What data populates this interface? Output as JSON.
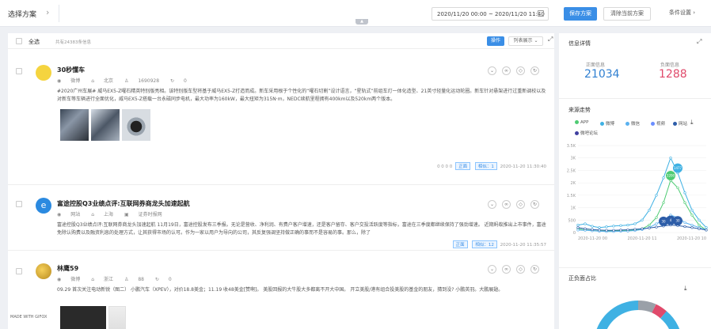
{
  "topbar": {
    "scheme_label": "选择方案",
    "date_range": "2020/11/20 00:00 ~ 2020/11/20 11:40",
    "save_label": "保存方案",
    "clear_label": "清除当前方案",
    "condition_label": "条件设置"
  },
  "list": {
    "select_all": "全选",
    "total": "共有24383条信息",
    "op_label": "操作",
    "list_mode": "列表展示"
  },
  "items": [
    {
      "title": "30秒懂车",
      "source": "微博",
      "location": "北京",
      "followers": "1690928",
      "reposts": "0",
      "content": "#2020广州车展# 威马EX5-Z曜石精英特别版亮相。该特别版车型将基于威马EX5-Z打造而成。新车采用根于个性化的“曜石切割”设计语言，“星轨式”前组车灯一体化造型、21英寸轻量化运动轮圈。新车针对悬架进行过重新调校以及对新车等车辆进行全面优化，威马EX5-Z搭载一台永磁同步电机，最大功率为160kW，最大扭矩为315N·m，NEDC续航里程拥有400km以及520km两个版本。",
      "stats": "0  0  0  0",
      "tag1": "正面",
      "tag2": "相似：1",
      "time": "2020-11-20 11:30:40"
    },
    {
      "title": "富途控股Q3业绩点评:互联网券商龙头加速起航",
      "source": "网站",
      "location": "上海",
      "extra": "证券时报网",
      "content": "富途控股Q3业绩点评:互联网券商龙头加速起航 11月19日，富途控股发布三季报。无论是营收、净利润、有费户客户增速，还是客户留存、客户交投活跃度等指标，富途在三季度都继续保持了强劲增速。 近期蚂蚁推出上市事件，富途免除认购费以及融资利息的处理方式，让其获得市场的认可。作为一家以用户为导向的公司，其反复强调坚持做正确的事而不是容易的事。那么，除了",
      "tag1": "正面",
      "tag2": "相似：12",
      "time": "2020-11-20 11:35:57"
    },
    {
      "title": "林鹰59",
      "source": "微博",
      "location": "浙江",
      "followers": "88",
      "reposts": "0",
      "content": "09.29  首次关注电动新锐（图二） 小鹏汽车（XPEV），对价18.8美金；11.19  收48美金[赞啊]。 美股回报的大牛股大多都离不开大中国。 开立美股/港有组合投美股的基金的朋友，猜到没?  小鹏英羽。大鹏展翅。"
    }
  ],
  "sidebar": {
    "info_title": "信息详情",
    "positive_label": "正面信息",
    "positive_value": "21034",
    "negative_label": "负面信息",
    "negative_value": "1288",
    "trend_title": "来源走势",
    "legend": [
      "APP",
      "微博",
      "微信",
      "视频",
      "网站",
      "微吧论坛"
    ],
    "pie_title": "正负面占比"
  },
  "chart_data": {
    "type": "line",
    "title": "来源走势",
    "y_ticks": [
      "0",
      "500",
      "1K",
      "1.5K",
      "2K",
      "2.5K",
      "3K",
      "3.5K"
    ],
    "x_ticks": [
      "2020-11-20 00",
      "2020-11-20 11",
      "2020-11-20 10"
    ],
    "ylim": [
      0,
      3500
    ],
    "colors": {
      "APP": "#4ecb73",
      "微博": "#3fb1e3",
      "微信": "#5ab1ef",
      "视频": "#6b8eff",
      "网站": "#2d5da8",
      "微吧论坛": "#3f3fa0"
    },
    "series": [
      {
        "name": "微博",
        "values": [
          300,
          350,
          250,
          200,
          230,
          260,
          280,
          300,
          350,
          500,
          900,
          1500,
          2200,
          3000,
          2400,
          1600,
          900,
          500,
          200
        ]
      },
      {
        "name": "APP",
        "values": [
          150,
          100,
          80,
          60,
          60,
          70,
          80,
          90,
          100,
          150,
          300,
          600,
          1200,
          2100,
          1800,
          1200,
          700,
          300,
          100
        ]
      },
      {
        "name": "微信",
        "values": [
          100,
          90,
          70,
          50,
          40,
          40,
          50,
          60,
          80,
          120,
          200,
          350,
          500,
          700,
          600,
          400,
          300,
          200,
          100
        ]
      },
      {
        "name": "网站",
        "values": [
          200,
          150,
          120,
          100,
          90,
          90,
          100,
          110,
          130,
          150,
          180,
          220,
          260,
          300,
          280,
          240,
          200,
          150,
          100
        ]
      }
    ],
    "point_labels": [
      {
        "series": "APP",
        "index": 13,
        "text": "3200"
      },
      {
        "series": "微博",
        "index": 14,
        "text": "1477"
      },
      {
        "series": "网站",
        "index": 12,
        "text": "30"
      },
      {
        "series": "网站",
        "index": 13,
        "text": "4"
      },
      {
        "series": "网站",
        "index": 14,
        "text": "30"
      }
    ]
  },
  "made_with": "MADE WITH GIFOX"
}
